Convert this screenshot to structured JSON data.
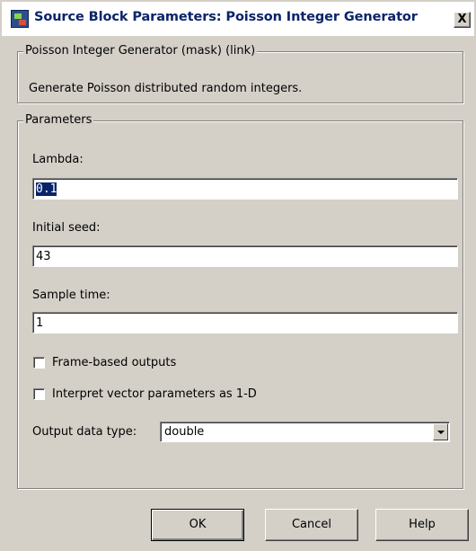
{
  "window": {
    "title": "Source Block Parameters: Poisson Integer Generator",
    "close_label": "X"
  },
  "block": {
    "group_title": "Poisson Integer Generator (mask) (link)",
    "description": "Generate Poisson distributed random integers."
  },
  "parameters": {
    "group_title": "Parameters",
    "lambda": {
      "label": "Lambda:",
      "value": "0.1"
    },
    "initial_seed": {
      "label": "Initial seed:",
      "value": "43"
    },
    "sample_time": {
      "label": "Sample time:",
      "value": "1"
    },
    "frame_based": {
      "label": "Frame-based outputs",
      "checked": false
    },
    "interpret_vector": {
      "label": "Interpret vector parameters as 1-D",
      "checked": false
    },
    "output_data_type": {
      "label": "Output data type:",
      "value": "double"
    }
  },
  "buttons": {
    "ok": "OK",
    "cancel": "Cancel",
    "help": "Help"
  },
  "icons": {
    "app": "simulink-block-icon",
    "dropdown": "chevron-down-icon"
  },
  "colors": {
    "title_text": "#0a246a",
    "dialog_bg": "#d4d0c8",
    "selection": "#0a246a"
  }
}
